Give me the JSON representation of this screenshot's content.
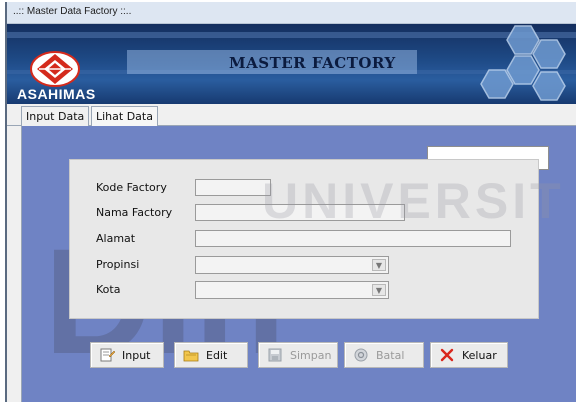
{
  "window": {
    "title": "..:: Master Data Factory ::.."
  },
  "banner": {
    "title": "MASTER FACTORY",
    "brand": "ASAHIMAS"
  },
  "tabs": [
    {
      "label": "Input Data",
      "active": true
    },
    {
      "label": "Lihat Data",
      "active": false
    }
  ],
  "watermark": {
    "top": "UNIVERSIT",
    "bottom": "Din"
  },
  "form": {
    "labels": {
      "kode": "Kode Factory",
      "nama": "Nama Factory",
      "alamat": "Alamat",
      "propinsi": "Propinsi",
      "kota": "Kota"
    },
    "values": {
      "kode": "",
      "nama": "",
      "alamat": "",
      "propinsi": "",
      "kota": ""
    }
  },
  "buttons": {
    "input": "Input",
    "edit": "Edit",
    "simpan": "Simpan",
    "batal": "Batal",
    "keluar": "Keluar"
  },
  "colors": {
    "banner": "#1e4a86",
    "content_bg": "#6f83c4",
    "close_x": "#d9261c"
  }
}
